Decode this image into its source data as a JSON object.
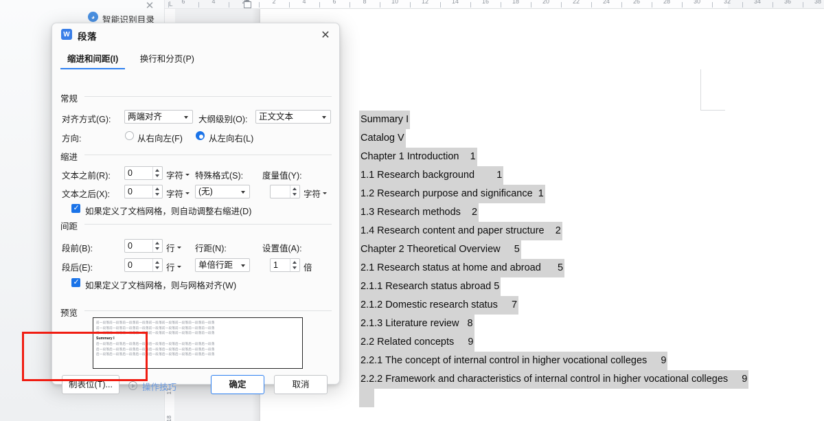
{
  "app": {
    "left_pane_tab": "智能识别目录",
    "left_pane_tab_icon": "robot-circle-icon",
    "close_icon": "close-icon"
  },
  "ruler": {
    "origin_label": "L",
    "h_ticks": [
      "6",
      "4",
      "2",
      "2",
      "4",
      "6",
      "8",
      "10",
      "12",
      "14",
      "16",
      "18",
      "20",
      "22",
      "24",
      "26",
      "28",
      "30",
      "32",
      "34",
      "36",
      "38"
    ],
    "v_ticks": [
      "17",
      "18"
    ],
    "indent_marker": "first-line-indent-marker"
  },
  "document": {
    "toc_title": "",
    "lines": [
      "Summary I",
      "Catalog V",
      "Chapter 1 Introduction    1",
      "1.1 Research background        1",
      "1.2 Research purpose and significance  1",
      "1.3 Research methods    2",
      "1.4 Research content and paper structure    2",
      "Chapter 2 Theoretical Overview     5",
      "2.1 Research status at home and abroad      5",
      "2.1.1 Research status abroad 5",
      "2.1.2 Domestic research status     7",
      "2.1.3 Literature review   8",
      "2.2 Related concepts     9",
      "2.2.1 The concept of internal control in higher vocational colleges     9",
      "2.2.2 Framework and characteristics of internal control in higher vocational colleges     9"
    ]
  },
  "dialog": {
    "title": "段落",
    "icon": "wps-writer-icon",
    "close_icon": "close-icon",
    "tabs": [
      {
        "label": "缩进和间距(I)",
        "active": true
      },
      {
        "label": "换行和分页(P)",
        "active": false
      }
    ],
    "general": {
      "section_label": "常规",
      "alignment_label": "对齐方式(G):",
      "alignment_value": "两端对齐",
      "outline_label": "大纲级别(O):",
      "outline_value": "正文文本",
      "direction_label": "方向:",
      "direction_rtl": "从右向左(F)",
      "direction_ltr": "从左向右(L)",
      "direction_selected": "ltr"
    },
    "indent": {
      "section_label": "缩进",
      "before_text_label": "文本之前(R):",
      "before_text_value": "0",
      "before_text_unit": "字符",
      "after_text_label": "文本之后(X):",
      "after_text_value": "0",
      "after_text_unit": "字符",
      "special_label": "特殊格式(S):",
      "special_value": "(无)",
      "measure_label": "度量值(Y):",
      "measure_value": "",
      "measure_unit": "字符",
      "grid_checkbox_label": "如果定义了文档网格，则自动调整右缩进(D)",
      "grid_checkbox_checked": true
    },
    "spacing": {
      "section_label": "间距",
      "before_label": "段前(B):",
      "before_value": "0",
      "before_unit": "行",
      "after_label": "段后(E):",
      "after_value": "0",
      "after_unit": "行",
      "line_spacing_label": "行距(N):",
      "line_spacing_value": "单倍行距",
      "set_value_label": "设置值(A):",
      "set_value": "1",
      "set_value_unit": "倍",
      "grid_checkbox_label": "如果定义了文档网格，则与网格对齐(W)",
      "grid_checkbox_checked": true
    },
    "preview": {
      "section_label": "预览",
      "before_line": "前一段落前一段落前一段落前一段落前一段落前一段落前一段落前一段落前一段落",
      "sample_line": "Summary I",
      "after_line": "后一段落后一段落后一段落后一段落后一段落后一段落后一段落后一段落后一段落"
    },
    "footer": {
      "tabs_button": "制表位(T)...",
      "tips_link": "操作技巧",
      "tips_icon": "play-circle-icon",
      "ok_button": "确定",
      "cancel_button": "取消"
    }
  },
  "annotation": {
    "highlight_color": "#f01c11",
    "target": "制表位按钮区域"
  }
}
